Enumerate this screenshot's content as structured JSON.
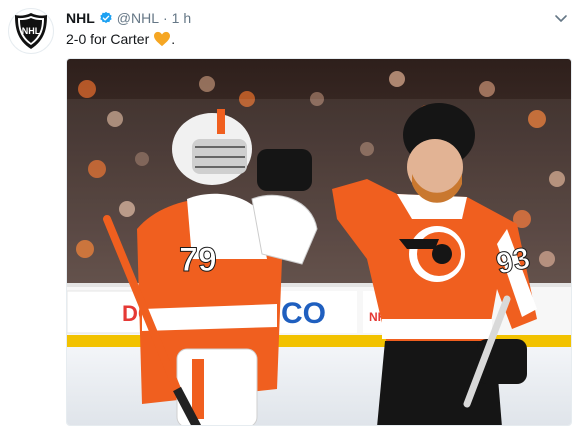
{
  "tweet": {
    "author_name": "NHL",
    "handle": "@NHL",
    "separator": "·",
    "time": "1 h",
    "text": "2-0 for Carter",
    "text_suffix": ".",
    "emoji_icon": "orange-heart-icon",
    "verified_icon": "verified-badge-icon",
    "menu_icon": "chevron-down-icon",
    "avatar_icon": "nhl-shield-logo-icon",
    "avatar_text": "NHL"
  },
  "media": {
    "left_jersey_number": "79",
    "right_jersey_number": "93",
    "board_text_left": "DO",
    "board_text_mid": "CO",
    "board_text_right": "NHL",
    "colors": {
      "flyers_orange": "#f05f1f",
      "ice": "#e9edf2",
      "crowd": "#3b2a25",
      "verified_blue": "#1da1f2",
      "heart_orange": "#f5a623"
    }
  }
}
